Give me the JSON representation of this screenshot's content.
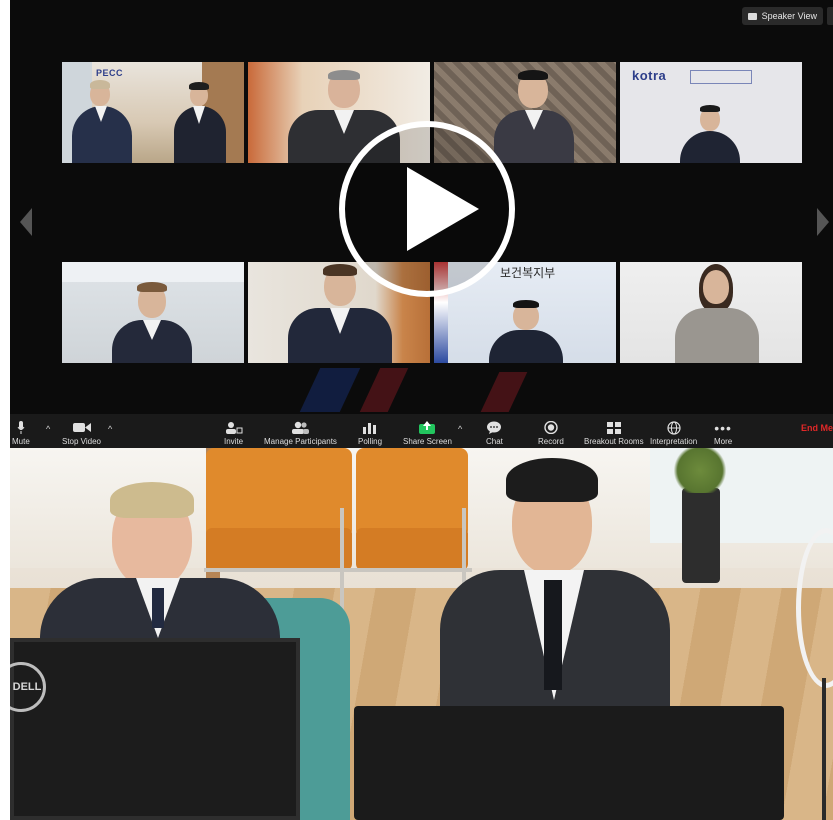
{
  "window": {
    "view_button_label": "Speaker View"
  },
  "tiles": [
    {
      "name": "tile-pecc",
      "logo_text": "PECC"
    },
    {
      "name": "tile-participant-2"
    },
    {
      "name": "tile-participant-3"
    },
    {
      "name": "tile-kotra",
      "logo_text": "kotra"
    },
    {
      "name": "tile-participant-5"
    },
    {
      "name": "tile-participant-6"
    },
    {
      "name": "tile-ministry",
      "sign_text": "보건복지부"
    },
    {
      "name": "tile-participant-8"
    }
  ],
  "toolbar": {
    "mute_label": "Mute",
    "stop_video_label": "Stop Video",
    "invite_label": "Invite",
    "manage_participants_label": "Manage Participants",
    "polling_label": "Polling",
    "share_screen_label": "Share Screen",
    "chat_label": "Chat",
    "record_label": "Record",
    "breakout_rooms_label": "Breakout Rooms",
    "interpretation_label": "Interpretation",
    "more_label": "More",
    "end_meeting_label": "End Meet"
  },
  "room_photo": {
    "monitor_brand": "DELL"
  },
  "icons": {
    "mute": "microphone-icon",
    "video": "video-camera-icon",
    "invite": "add-person-icon",
    "participants": "people-icon",
    "polling": "bar-chart-icon",
    "share": "share-arrow-icon",
    "chat": "chat-bubble-icon",
    "record": "record-icon",
    "breakout": "grid-icon",
    "interpretation": "globe-icon",
    "more": "ellipsis-icon",
    "play": "play-icon"
  },
  "colors": {
    "window_bg": "#0b0b0b",
    "toolbar_bg": "#1a1a1a",
    "share_green": "#22c55e",
    "end_red": "#e02828",
    "chair_orange": "#e08a2c"
  }
}
